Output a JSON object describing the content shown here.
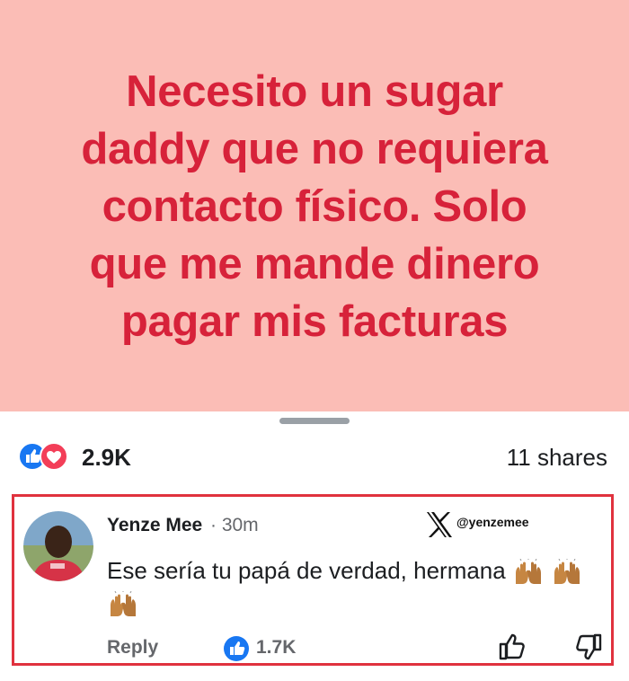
{
  "post": {
    "lines": [
      "Necesito un sugar",
      "daddy que no requiera",
      "contacto físico. Solo",
      "que me mande dinero",
      "pagar mis facturas"
    ],
    "background_color": "#fbbdb6",
    "text_color": "#d7223a"
  },
  "stats": {
    "reactions": [
      "like-icon",
      "love-icon"
    ],
    "reaction_count": "2.9K",
    "shares": "11 shares"
  },
  "comment": {
    "author": "Yenze Mee",
    "time": "· 30m",
    "watermark_handle": "@yenzemee",
    "text": "Ese sería tu papá de verdad, hermana",
    "reply_label": "Reply",
    "like_count": "1.7K",
    "highlight_color": "#e0323e"
  }
}
